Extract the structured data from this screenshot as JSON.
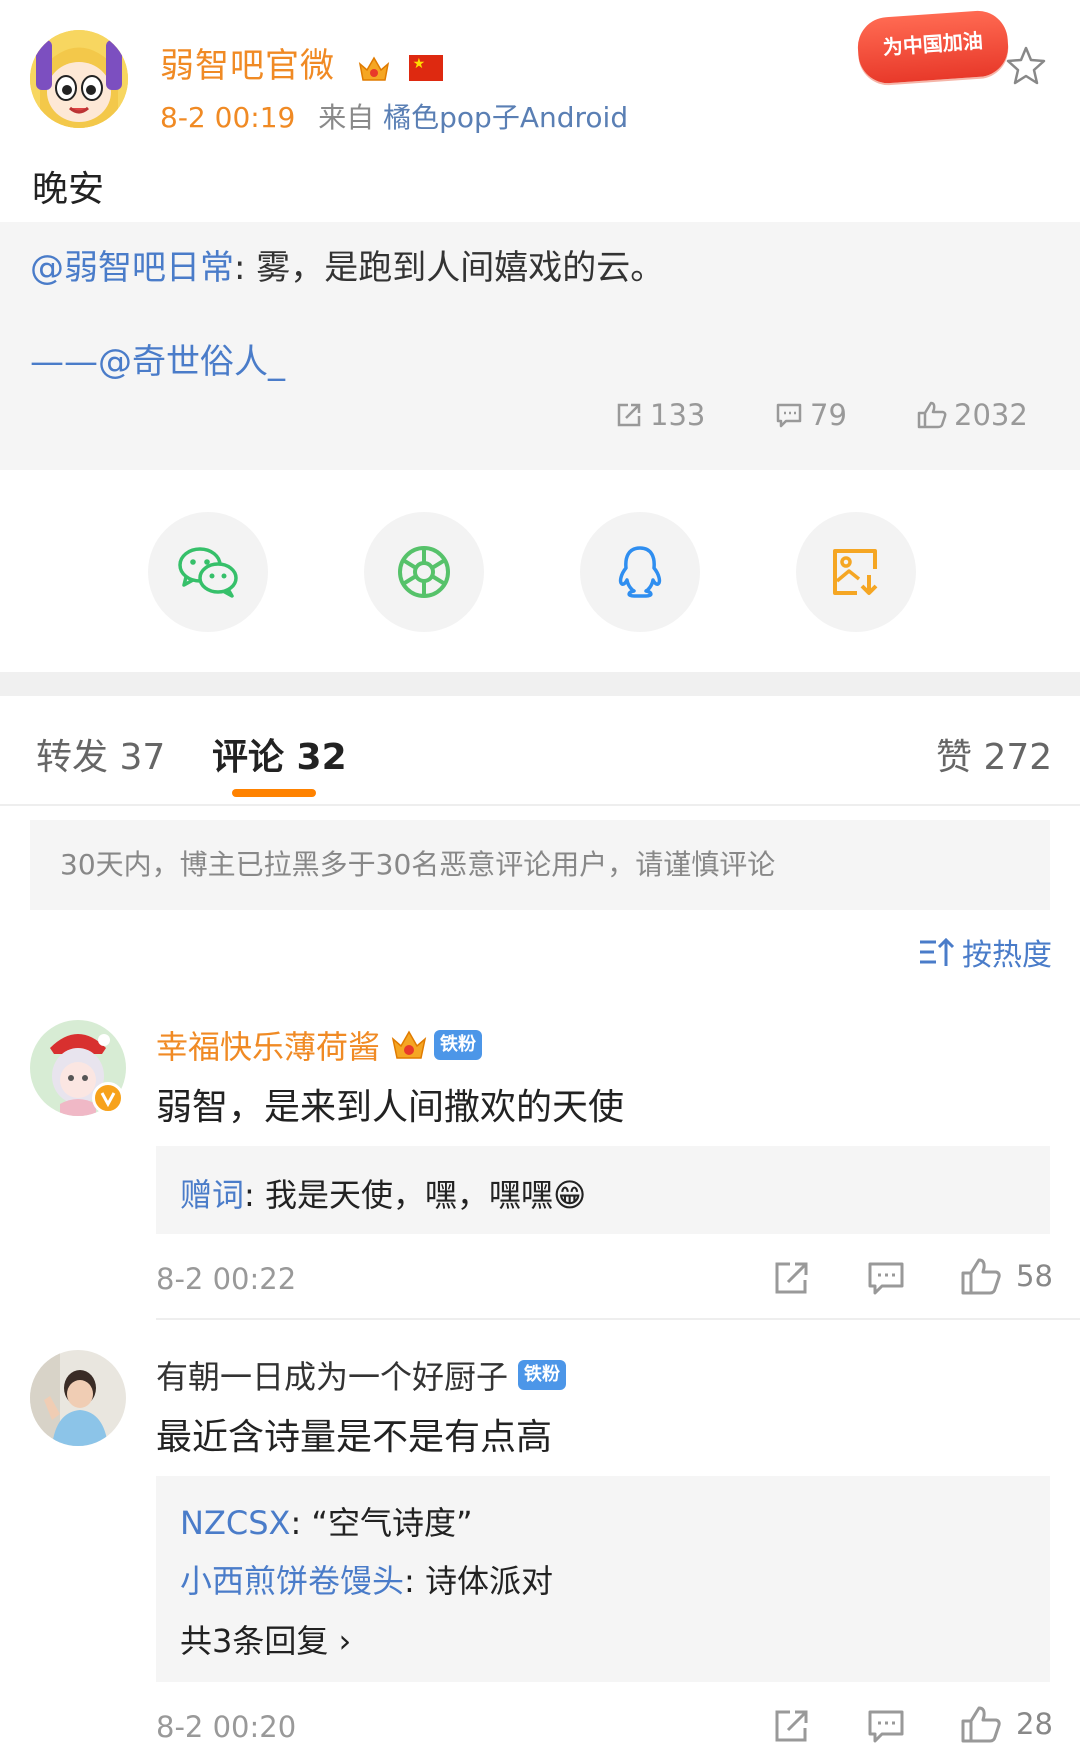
{
  "post": {
    "author": "弱智吧官微",
    "time": "8-2 00:19",
    "source_prefix": "来自",
    "source": "橘色pop子Android",
    "badge_text": "为中国加油",
    "text": "晚安",
    "repost": {
      "mention": "@弱智吧日常",
      "content": ": 雾，是跑到人间嬉戏的云。",
      "credit": "——@奇世俗人_",
      "reposts": "133",
      "comments": "79",
      "likes": "2032"
    }
  },
  "share": {
    "items": [
      "wechat-icon",
      "moments-icon",
      "qq-icon",
      "save-image-icon"
    ],
    "colors": [
      "#36c06a",
      "#56c26a",
      "#2f8ef0",
      "#f5a623"
    ]
  },
  "tabs": {
    "forward": "转发 37",
    "comments": "评论 32",
    "likes": "赞 272"
  },
  "notice": "30天内，博主已拉黑多于30名恶意评论用户，请谨慎评论",
  "sort_label": "按热度",
  "comments": [
    {
      "name": "幸福快乐薄荷酱",
      "badge": "铁粉",
      "text": "弱智，是来到人间撒欢的天使",
      "replies": [
        {
          "user": "赠词",
          "text": ": 我是天使，嘿，嘿嘿😁"
        }
      ],
      "time": "8-2 00:22",
      "likes": "58"
    },
    {
      "name": "有朝一日成为一个好厨子",
      "badge": "铁粉",
      "text": "最近含诗量是不是有点高",
      "replies": [
        {
          "user": "NZCSX",
          "text": ": “空气诗度”"
        },
        {
          "user": "小西煎饼卷馒头",
          "text": ": 诗体派对"
        }
      ],
      "more_replies": "共3条回复 ›",
      "time": "8-2 00:20",
      "likes": "28"
    }
  ],
  "colors": {
    "orange": "#f08a24",
    "link_blue": "#4a7cc9",
    "tab_accent": "#ff8200"
  }
}
